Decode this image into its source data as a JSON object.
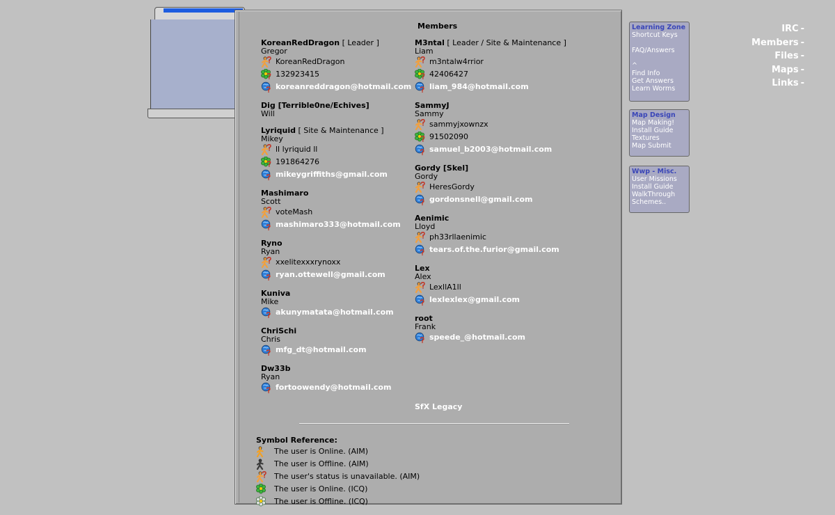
{
  "nav": {
    "items": [
      {
        "label": "IRC",
        "sep": "-"
      },
      {
        "label": "Members",
        "sep": "-"
      },
      {
        "label": "Files",
        "sep": "-"
      },
      {
        "label": "Maps",
        "sep": "-"
      },
      {
        "label": "Links",
        "sep": "-"
      }
    ]
  },
  "main": {
    "title": "Members",
    "left_members": [
      {
        "handle": "KoreanRedDragon",
        "role": " [ Leader ]",
        "name": "Gregor",
        "aim": "KoreanRedDragon",
        "icq": "132923415",
        "email": "koreanreddragon@hotmail.com"
      },
      {
        "handle": "Dig [Terrible0ne/Echives]",
        "role": "",
        "name": "Will"
      },
      {
        "handle": "Lyriquid",
        "role": " [ Site & Maintenance ]",
        "name": "Mikey",
        "aim": "ll lyriquid ll",
        "icq": "191864276",
        "email": "mikeygriffiths@gmail.com"
      },
      {
        "handle": "Mashimaro",
        "role": "",
        "name": "Scott",
        "aim": "voteMash",
        "email": "mashimaro333@hotmail.com"
      },
      {
        "handle": "Ryno",
        "role": "",
        "name": "Ryan",
        "aim": "xxelitexxxrynoxx",
        "email": "ryan.ottewell@gmail.com"
      },
      {
        "handle": "Kuniva",
        "role": "",
        "name": "Mike",
        "email": "akunymatata@hotmail.com"
      },
      {
        "handle": "ChriSchi",
        "role": "",
        "name": "Chris",
        "email": "mfg_dt@hotmail.com"
      },
      {
        "handle": "Dw33b",
        "role": "",
        "name": "Ryan",
        "email": "fortoowendy@hotmail.com"
      }
    ],
    "right_members": [
      {
        "handle": "M3ntal",
        "role": " [ Leader / Site & Maintenance ]",
        "name": "Liam",
        "aim": "m3ntalw4rrior",
        "icq": "42406427",
        "email": "liam_984@hotmail.com"
      },
      {
        "handle": "SammyJ",
        "role": "",
        "name": "Sammy",
        "aim": "sammyjxownzx",
        "icq": "91502090",
        "email": "samuel_b2003@hotmail.com"
      },
      {
        "handle": "Gordy [Skel]",
        "role": "",
        "name": "Gordy",
        "aim": "HeresGordy",
        "email": "gordonsnell@gmail.com"
      },
      {
        "handle": "Aenimic",
        "role": "",
        "name": "Lloyd",
        "aim": "ph33rllaenimic",
        "email": "tears.of.the.furior@gmail.com"
      },
      {
        "handle": "Lex",
        "role": "",
        "name": "Alex",
        "aim": "LexllA1ll",
        "email": "lexlexlex@gmail.com"
      },
      {
        "handle": "root",
        "role": "",
        "name": "Frank",
        "email": "speede_@hotmail.com"
      }
    ],
    "legacy": "SfX Legacy",
    "symbol_reference": {
      "title": "Symbol Reference:",
      "items": [
        {
          "icon": "aim-online-icon",
          "text": "The user is Online. (AIM)"
        },
        {
          "icon": "aim-offline-icon",
          "text": "The user is Offline. (AIM)"
        },
        {
          "icon": "aim-unknown-icon",
          "text": "The user's status is unavailable. (AIM)"
        },
        {
          "icon": "icq-online-icon",
          "text": "The user is Online. (ICQ)"
        },
        {
          "icon": "icq-offline-icon",
          "text": "The user is Offline. (ICQ)"
        }
      ]
    }
  },
  "sidebar": {
    "learning_zone": {
      "title": "Learning Zone",
      "items": [
        "Shortcut Keys",
        "",
        "FAQ/Answers",
        "",
        "^",
        "Find Info",
        "Get Answers",
        "Learn Worms"
      ]
    },
    "map_design": {
      "title": "Map Design",
      "items": [
        "Map Making!",
        "Install Guide",
        "Textures",
        "Map Submit"
      ]
    },
    "wwp_misc": {
      "title": "Wwp - Misc.",
      "items": [
        "User Missions",
        "Install Guide",
        "WalkThrough",
        "Schemes.."
      ]
    }
  },
  "colors": {
    "background": "#c1c1c1",
    "nav_body": "#a7b0cc",
    "nav_accent": "#1e5de0",
    "content": "#adadad",
    "sidebar_box": "#a9aac3",
    "sidebar_title": "#3a46b8"
  }
}
